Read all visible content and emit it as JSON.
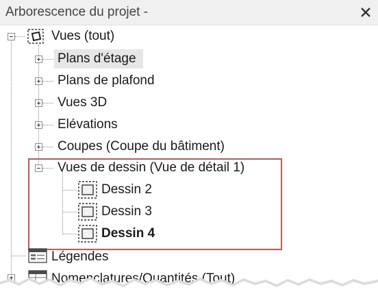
{
  "panel": {
    "title": "Arborescence du projet -"
  },
  "tree": {
    "root_label": "Vues (tout)",
    "items": [
      {
        "label": "Plans d'étage"
      },
      {
        "label": "Plans de plafond"
      },
      {
        "label": "Vues 3D"
      },
      {
        "label": "Elévations"
      },
      {
        "label": "Coupes (Coupe du bâtiment)"
      },
      {
        "label": "Vues de dessin (Vue de détail 1)"
      }
    ],
    "drawing_views": [
      {
        "label": "Dessin 2"
      },
      {
        "label": "Dessin 3"
      },
      {
        "label": "Dessin 4"
      }
    ],
    "legends_label": "Légendes",
    "schedules_label": "Nomenclatures/Quantités (Tout)"
  },
  "colors": {
    "highlight_box": "#e05050",
    "selection_bg": "#e6e6e6",
    "header_bg": "#f0f0f0"
  }
}
